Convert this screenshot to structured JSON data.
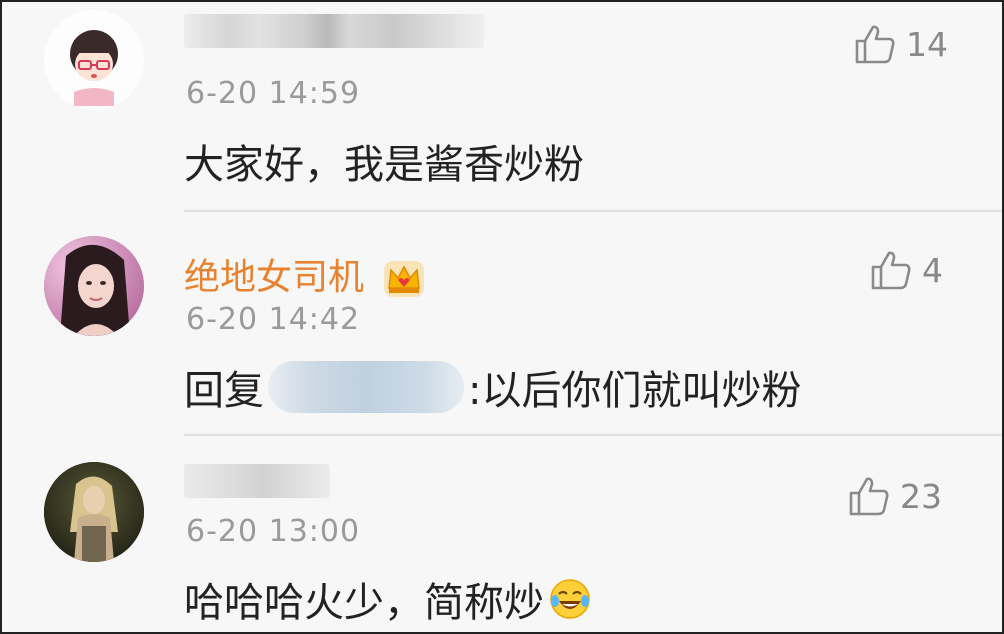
{
  "comments": [
    {
      "username": "",
      "timestamp": "6-20 14:59",
      "text": "大家好，我是酱香炒粉",
      "likes": "14",
      "vip": false
    },
    {
      "username": "绝地女司机",
      "timestamp": "6-20 14:42",
      "reply_prefix": "回复",
      "text": ":以后你们就叫炒粉",
      "likes": "4",
      "vip": true
    },
    {
      "username": "",
      "timestamp": "6-20 13:00",
      "text": "哈哈哈火少，简称炒",
      "emoji": "laughing-tears-emoji",
      "likes": "23",
      "vip": false
    }
  ],
  "icons": {
    "like": "thumbs-up-icon",
    "vip": "crown-icon"
  },
  "colors": {
    "vip_username": "#e9822f",
    "timestamp": "#9a9a9a",
    "like": "#888888",
    "text": "#222222"
  }
}
